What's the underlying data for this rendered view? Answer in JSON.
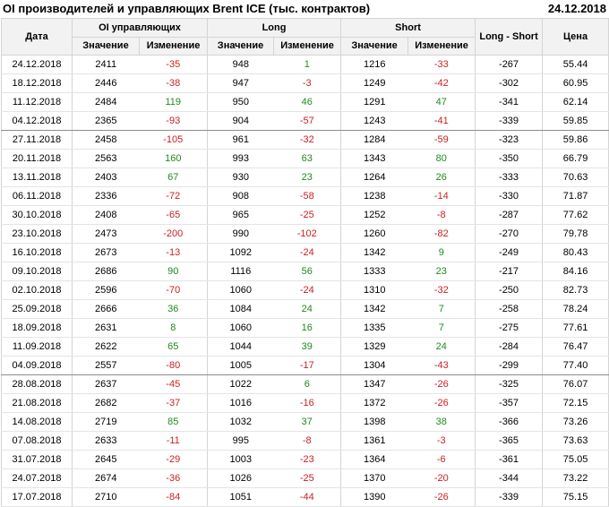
{
  "title": "OI производителей и управляющих Brent ICE (тыс. контрактов)",
  "date": "24.12.2018",
  "columns": {
    "date": "Дата",
    "oi_group": "OI управляющих",
    "long_group": "Long",
    "short_group": "Short",
    "long_minus_short": "Long - Short",
    "price": "Цена",
    "value": "Значение",
    "change": "Изменение"
  },
  "colors": {
    "positive": "#1f8a1f",
    "negative": "#cc1f1f",
    "header_bg": "#f2f2f2"
  },
  "group_separators_after_rows": [
    3,
    16
  ],
  "rows": [
    {
      "date": "24.12.2018",
      "oi": "2411",
      "oi_chg": "-35",
      "long": "948",
      "long_chg": "1",
      "short": "1216",
      "short_chg": "-33",
      "ls": "-267",
      "price": "55.44"
    },
    {
      "date": "18.12.2018",
      "oi": "2446",
      "oi_chg": "-38",
      "long": "947",
      "long_chg": "-3",
      "short": "1249",
      "short_chg": "-42",
      "ls": "-302",
      "price": "60.95"
    },
    {
      "date": "11.12.2018",
      "oi": "2484",
      "oi_chg": "119",
      "long": "950",
      "long_chg": "46",
      "short": "1291",
      "short_chg": "47",
      "ls": "-341",
      "price": "62.14"
    },
    {
      "date": "04.12.2018",
      "oi": "2365",
      "oi_chg": "-93",
      "long": "904",
      "long_chg": "-57",
      "short": "1243",
      "short_chg": "-41",
      "ls": "-339",
      "price": "59.85"
    },
    {
      "date": "27.11.2018",
      "oi": "2458",
      "oi_chg": "-105",
      "long": "961",
      "long_chg": "-32",
      "short": "1284",
      "short_chg": "-59",
      "ls": "-323",
      "price": "59.86"
    },
    {
      "date": "20.11.2018",
      "oi": "2563",
      "oi_chg": "160",
      "long": "993",
      "long_chg": "63",
      "short": "1343",
      "short_chg": "80",
      "ls": "-350",
      "price": "66.79"
    },
    {
      "date": "13.11.2018",
      "oi": "2403",
      "oi_chg": "67",
      "long": "930",
      "long_chg": "23",
      "short": "1264",
      "short_chg": "26",
      "ls": "-333",
      "price": "70.63"
    },
    {
      "date": "06.11.2018",
      "oi": "2336",
      "oi_chg": "-72",
      "long": "908",
      "long_chg": "-58",
      "short": "1238",
      "short_chg": "-14",
      "ls": "-330",
      "price": "71.87"
    },
    {
      "date": "30.10.2018",
      "oi": "2408",
      "oi_chg": "-65",
      "long": "965",
      "long_chg": "-25",
      "short": "1252",
      "short_chg": "-8",
      "ls": "-287",
      "price": "77.62"
    },
    {
      "date": "23.10.2018",
      "oi": "2473",
      "oi_chg": "-200",
      "long": "990",
      "long_chg": "-102",
      "short": "1260",
      "short_chg": "-82",
      "ls": "-270",
      "price": "79.78"
    },
    {
      "date": "16.10.2018",
      "oi": "2673",
      "oi_chg": "-13",
      "long": "1092",
      "long_chg": "-24",
      "short": "1342",
      "short_chg": "9",
      "ls": "-249",
      "price": "80.43"
    },
    {
      "date": "09.10.2018",
      "oi": "2686",
      "oi_chg": "90",
      "long": "1116",
      "long_chg": "56",
      "short": "1333",
      "short_chg": "23",
      "ls": "-217",
      "price": "84.16"
    },
    {
      "date": "02.10.2018",
      "oi": "2596",
      "oi_chg": "-70",
      "long": "1060",
      "long_chg": "-24",
      "short": "1310",
      "short_chg": "-32",
      "ls": "-250",
      "price": "82.73"
    },
    {
      "date": "25.09.2018",
      "oi": "2666",
      "oi_chg": "36",
      "long": "1084",
      "long_chg": "24",
      "short": "1342",
      "short_chg": "7",
      "ls": "-258",
      "price": "78.24"
    },
    {
      "date": "18.09.2018",
      "oi": "2631",
      "oi_chg": "8",
      "long": "1060",
      "long_chg": "16",
      "short": "1335",
      "short_chg": "7",
      "ls": "-275",
      "price": "77.61"
    },
    {
      "date": "11.09.2018",
      "oi": "2622",
      "oi_chg": "65",
      "long": "1044",
      "long_chg": "39",
      "short": "1329",
      "short_chg": "24",
      "ls": "-284",
      "price": "76.47"
    },
    {
      "date": "04.09.2018",
      "oi": "2557",
      "oi_chg": "-80",
      "long": "1005",
      "long_chg": "-17",
      "short": "1304",
      "short_chg": "-43",
      "ls": "-299",
      "price": "77.40"
    },
    {
      "date": "28.08.2018",
      "oi": "2637",
      "oi_chg": "-45",
      "long": "1022",
      "long_chg": "6",
      "short": "1347",
      "short_chg": "-26",
      "ls": "-325",
      "price": "76.07"
    },
    {
      "date": "21.08.2018",
      "oi": "2682",
      "oi_chg": "-37",
      "long": "1016",
      "long_chg": "-16",
      "short": "1372",
      "short_chg": "-26",
      "ls": "-357",
      "price": "72.15"
    },
    {
      "date": "14.08.2018",
      "oi": "2719",
      "oi_chg": "85",
      "long": "1032",
      "long_chg": "37",
      "short": "1398",
      "short_chg": "38",
      "ls": "-366",
      "price": "73.26"
    },
    {
      "date": "07.08.2018",
      "oi": "2633",
      "oi_chg": "-11",
      "long": "995",
      "long_chg": "-8",
      "short": "1361",
      "short_chg": "-3",
      "ls": "-365",
      "price": "73.63"
    },
    {
      "date": "31.07.2018",
      "oi": "2645",
      "oi_chg": "-29",
      "long": "1003",
      "long_chg": "-23",
      "short": "1364",
      "short_chg": "-6",
      "ls": "-361",
      "price": "75.05"
    },
    {
      "date": "24.07.2018",
      "oi": "2674",
      "oi_chg": "-36",
      "long": "1026",
      "long_chg": "-25",
      "short": "1370",
      "short_chg": "-20",
      "ls": "-344",
      "price": "73.22"
    },
    {
      "date": "17.07.2018",
      "oi": "2710",
      "oi_chg": "-84",
      "long": "1051",
      "long_chg": "-44",
      "short": "1390",
      "short_chg": "-26",
      "ls": "-339",
      "price": "75.15"
    }
  ]
}
